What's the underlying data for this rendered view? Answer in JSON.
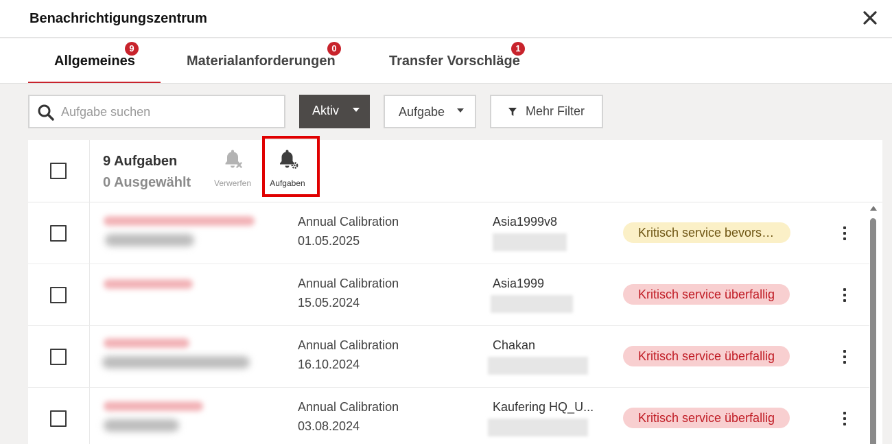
{
  "dialog": {
    "title": "Benachrichtigungszentrum"
  },
  "tabs": [
    {
      "label": "Allgemeines",
      "badge": "9"
    },
    {
      "label": "Materialanforderungen",
      "badge": "0"
    },
    {
      "label": "Transfer Vorschläge",
      "badge": "1"
    }
  ],
  "toolbar": {
    "search_placeholder": "Aufgabe suchen",
    "status_filter": "Aktiv",
    "type_filter": "Aufgabe",
    "more_filters": "Mehr Filter"
  },
  "list_header": {
    "count": "9 Aufgaben",
    "selected": "0 Ausgewählt",
    "dismiss_label": "Verwerfen",
    "tasks_label": "Aufgaben"
  },
  "rows": [
    {
      "task": "Annual Calibration",
      "date": "01.05.2025",
      "location": "Asia1999v8",
      "status": "Kritisch service bevorst…",
      "status_type": "warning"
    },
    {
      "task": "Annual Calibration",
      "date": "15.05.2024",
      "location": "Asia1999",
      "status": "Kritisch service überfallig",
      "status_type": "overdue"
    },
    {
      "task": "Annual Calibration",
      "date": "16.10.2024",
      "location": "Chakan",
      "status": "Kritisch service überfallig",
      "status_type": "overdue"
    },
    {
      "task": "Annual Calibration",
      "date": "03.08.2024",
      "location": "Kaufering HQ_U...",
      "status": "Kritisch service überfallig",
      "status_type": "overdue"
    }
  ],
  "colors": {
    "accent": "#c8232c",
    "highlight": "#e00000",
    "warning_bg": "#fbf0c7",
    "overdue_bg": "#f8cfd0",
    "overdue_text": "#c01c25"
  }
}
